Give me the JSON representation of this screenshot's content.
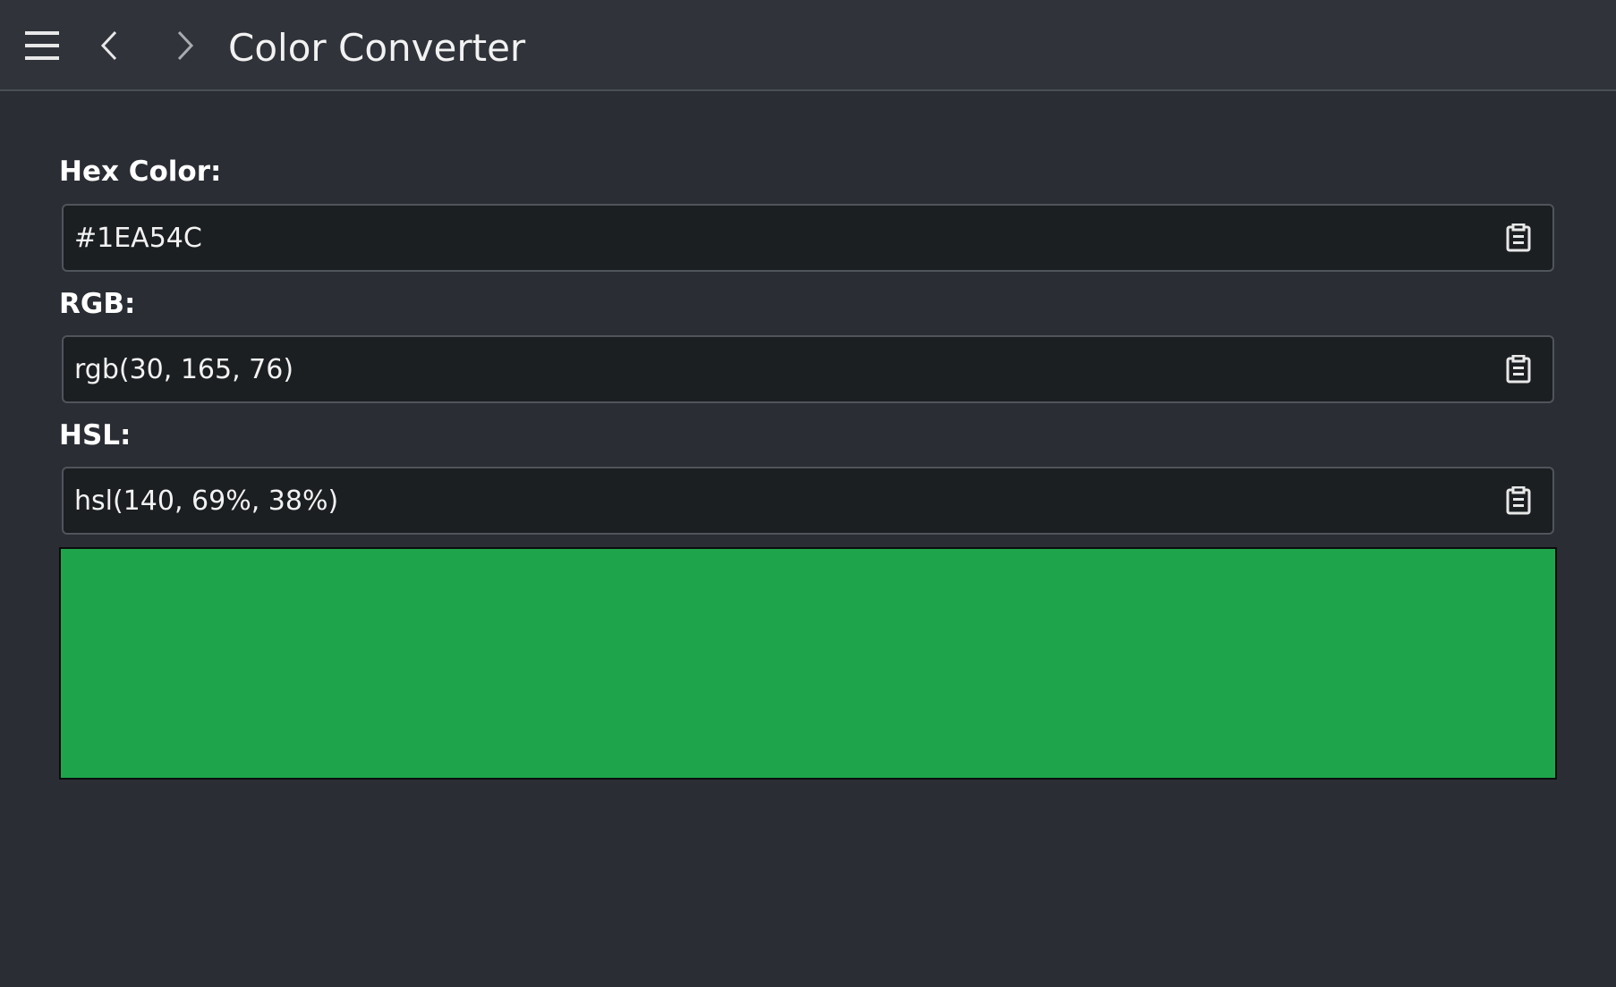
{
  "header": {
    "title": "Color Converter",
    "menu_icon": "hamburger-menu-icon",
    "back_icon": "chevron-left-icon",
    "forward_icon": "chevron-right-icon"
  },
  "fields": {
    "hex": {
      "label": "Hex Color:",
      "value": "#1EA54C",
      "copy_icon": "clipboard-icon"
    },
    "rgb": {
      "label": "RGB:",
      "value": "rgb(30, 165, 76)",
      "copy_icon": "clipboard-icon"
    },
    "hsl": {
      "label": "HSL:",
      "value": "hsl(140, 69%, 38%)",
      "copy_icon": "clipboard-icon"
    }
  },
  "preview": {
    "color": "#1EA54C"
  },
  "colors": {
    "background": "#2a2d33",
    "header_background": "#30343a",
    "input_background": "#1c1f22"
  }
}
